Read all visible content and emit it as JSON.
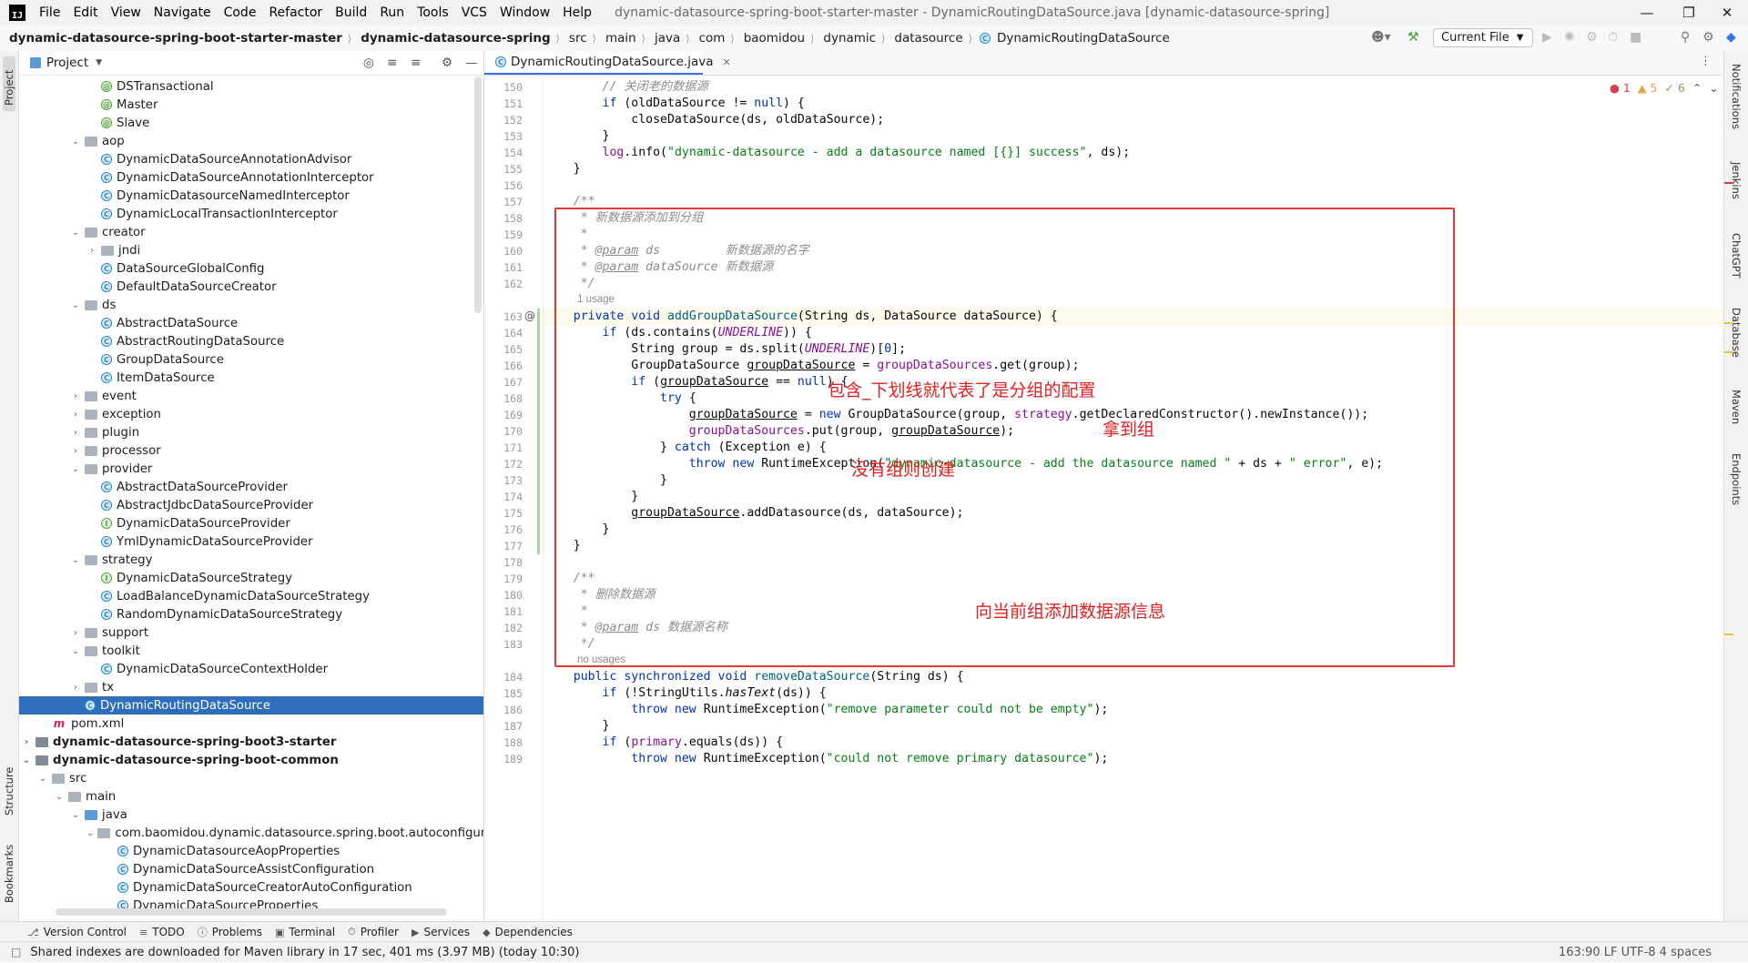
{
  "menubar": {
    "items": [
      "File",
      "Edit",
      "View",
      "Navigate",
      "Code",
      "Refactor",
      "Build",
      "Run",
      "Tools",
      "VCS",
      "Window",
      "Help"
    ],
    "window_title": "dynamic-datasource-spring-boot-starter-master - DynamicRoutingDataSource.java [dynamic-datasource-spring]",
    "logo_text": "IJ"
  },
  "navbar": {
    "breadcrumbs": [
      "dynamic-datasource-spring-boot-starter-master",
      "dynamic-datasource-spring",
      "src",
      "main",
      "java",
      "com",
      "baomidou",
      "dynamic",
      "datasource",
      "DynamicRoutingDataSource"
    ],
    "run_config": "Current File"
  },
  "project_panel": {
    "title": "Project",
    "rows": [
      {
        "label": "DSTransactional",
        "icon": "anno",
        "indent": 5
      },
      {
        "label": "Master",
        "icon": "anno",
        "indent": 5
      },
      {
        "label": "Slave",
        "icon": "anno",
        "indent": 5
      },
      {
        "label": "aop",
        "icon": "folder",
        "indent": 4,
        "arrow": "down"
      },
      {
        "label": "DynamicDataSourceAnnotationAdvisor",
        "icon": "class",
        "indent": 5
      },
      {
        "label": "DynamicDataSourceAnnotationInterceptor",
        "icon": "class",
        "indent": 5
      },
      {
        "label": "DynamicDatasourceNamedInterceptor",
        "icon": "class",
        "indent": 5
      },
      {
        "label": "DynamicLocalTransactionInterceptor",
        "icon": "class",
        "indent": 5
      },
      {
        "label": "creator",
        "icon": "folder",
        "indent": 4,
        "arrow": "down"
      },
      {
        "label": "jndi",
        "icon": "folder",
        "indent": 5,
        "arrow": "right"
      },
      {
        "label": "DataSourceGlobalConfig",
        "icon": "class",
        "indent": 5
      },
      {
        "label": "DefaultDataSourceCreator",
        "icon": "class",
        "indent": 5
      },
      {
        "label": "ds",
        "icon": "folder",
        "indent": 4,
        "arrow": "down"
      },
      {
        "label": "AbstractDataSource",
        "icon": "class",
        "indent": 5
      },
      {
        "label": "AbstractRoutingDataSource",
        "icon": "class",
        "indent": 5
      },
      {
        "label": "GroupDataSource",
        "icon": "class",
        "indent": 5
      },
      {
        "label": "ItemDataSource",
        "icon": "class",
        "indent": 5
      },
      {
        "label": "event",
        "icon": "folder",
        "indent": 4,
        "arrow": "right"
      },
      {
        "label": "exception",
        "icon": "folder",
        "indent": 4,
        "arrow": "right"
      },
      {
        "label": "plugin",
        "icon": "folder",
        "indent": 4,
        "arrow": "right"
      },
      {
        "label": "processor",
        "icon": "folder",
        "indent": 4,
        "arrow": "right"
      },
      {
        "label": "provider",
        "icon": "folder",
        "indent": 4,
        "arrow": "down"
      },
      {
        "label": "AbstractDataSourceProvider",
        "icon": "class",
        "indent": 5
      },
      {
        "label": "AbstractJdbcDataSourceProvider",
        "icon": "class",
        "indent": 5
      },
      {
        "label": "DynamicDataSourceProvider",
        "icon": "iface",
        "indent": 5
      },
      {
        "label": "YmlDynamicDataSourceProvider",
        "icon": "class",
        "indent": 5
      },
      {
        "label": "strategy",
        "icon": "folder",
        "indent": 4,
        "arrow": "down"
      },
      {
        "label": "DynamicDataSourceStrategy",
        "icon": "iface",
        "indent": 5
      },
      {
        "label": "LoadBalanceDynamicDataSourceStrategy",
        "icon": "class",
        "indent": 5
      },
      {
        "label": "RandomDynamicDataSourceStrategy",
        "icon": "class",
        "indent": 5
      },
      {
        "label": "support",
        "icon": "folder",
        "indent": 4,
        "arrow": "right"
      },
      {
        "label": "toolkit",
        "icon": "folder",
        "indent": 4,
        "arrow": "down"
      },
      {
        "label": "DynamicDataSourceContextHolder",
        "icon": "class",
        "indent": 5
      },
      {
        "label": "tx",
        "icon": "folder",
        "indent": 4,
        "arrow": "right"
      },
      {
        "label": "DynamicRoutingDataSource",
        "icon": "class",
        "indent": 4,
        "selected": true
      },
      {
        "label": "pom.xml",
        "icon": "maven",
        "indent": 2
      },
      {
        "label": "dynamic-datasource-spring-boot3-starter",
        "icon": "module",
        "indent": 1,
        "arrow": "right",
        "bold": true
      },
      {
        "label": "dynamic-datasource-spring-boot-common",
        "icon": "module",
        "indent": 1,
        "arrow": "down",
        "bold": true
      },
      {
        "label": "src",
        "icon": "folder",
        "indent": 2,
        "arrow": "down"
      },
      {
        "label": "main",
        "icon": "folder",
        "indent": 3,
        "arrow": "down"
      },
      {
        "label": "java",
        "icon": "folder-blue",
        "indent": 4,
        "arrow": "down"
      },
      {
        "label": "com.baomidou.dynamic.datasource.spring.boot.autoconfigure",
        "icon": "folder",
        "indent": 5,
        "arrow": "down"
      },
      {
        "label": "DynamicDatasourceAopProperties",
        "icon": "class",
        "indent": 6
      },
      {
        "label": "DynamicDataSourceAssistConfiguration",
        "icon": "class",
        "indent": 6
      },
      {
        "label": "DynamicDataSourceCreatorAutoConfiguration",
        "icon": "class",
        "indent": 6
      },
      {
        "label": "DynamicDataSourceProperties",
        "icon": "class",
        "indent": 6
      }
    ]
  },
  "editor": {
    "tab_label": "DynamicRoutingDataSource.java",
    "inspections": {
      "errors": "1",
      "warnings": "5",
      "weak": "6"
    },
    "lines": [
      {
        "n": "150",
        "html": "        <span class=\"cm\">// 关闭老的数据源</span>"
      },
      {
        "n": "151",
        "html": "        <span class=\"kw\">if</span> (oldDataSource != <span class=\"kw\">null</span>) {"
      },
      {
        "n": "152",
        "html": "            closeDataSource(ds, oldDataSource);"
      },
      {
        "n": "153",
        "html": "        }"
      },
      {
        "n": "154",
        "html": "        <span class=\"log\">log</span>.info(<span class=\"str\">\"dynamic-datasource - add a datasource named [{}] success\"</span>, ds);"
      },
      {
        "n": "155",
        "html": "    }"
      },
      {
        "n": "156",
        "html": ""
      },
      {
        "n": "157",
        "html": "    <span class=\"cj\">/**</span>"
      },
      {
        "n": "158",
        "html": "    <span class=\"cj\"> * 新数据源添加到分组</span>"
      },
      {
        "n": "159",
        "html": "    <span class=\"cj\"> *</span>"
      },
      {
        "n": "160",
        "html": "    <span class=\"cj\"> * <span class=\"tag\">@param</span> ds         新数据源的名字</span>"
      },
      {
        "n": "161",
        "html": "    <span class=\"cj\"> * <span class=\"tag\">@param</span> dataSource 新数据源</span>"
      },
      {
        "n": "162",
        "html": "    <span class=\"cj\"> */</span>"
      },
      {
        "n": "163",
        "html": "    <span class=\"kw\">private void</span> <span class=\"fn\">addGroupDataSource</span>(String ds, DataSource dataSource) {"
      },
      {
        "n": "164",
        "html": "        <span class=\"kw\">if</span> (ds.contains(<span class=\"const\">UNDERLINE</span>)) {"
      },
      {
        "n": "165",
        "html": "            String group = ds.split(<span class=\"const\">UNDERLINE</span>)[<span class=\"kw\">0</span>];"
      },
      {
        "n": "166",
        "html": "            GroupDataSource <span class=\"ul\">groupDataSource</span> = <span class=\"fld\">groupDataSources</span>.get(group);"
      },
      {
        "n": "167",
        "html": "            <span class=\"kw\">if</span> (<span class=\"ul\">groupDataSource</span> == <span class=\"kw\">null</span>) {"
      },
      {
        "n": "168",
        "html": "                <span class=\"kw\">try</span> {"
      },
      {
        "n": "169",
        "html": "                    <span class=\"ul\">groupDataSource</span> = <span class=\"kw\">new</span> GroupDataSource(group, <span class=\"fld\">strategy</span>.getDeclaredConstructor().newInstance());"
      },
      {
        "n": "170",
        "html": "                    <span class=\"fld\">groupDataSources</span>.put(group, <span class=\"ul\">groupDataSource</span>);"
      },
      {
        "n": "171",
        "html": "                } <span class=\"kw\">catch</span> (Exception e) {"
      },
      {
        "n": "172",
        "html": "                    <span class=\"kw\">throw new</span> RuntimeException(<span class=\"str\">\"dynamic-datasource - add the datasource named \"</span> + ds + <span class=\"str\">\" error\"</span>, e);"
      },
      {
        "n": "173",
        "html": "                }"
      },
      {
        "n": "174",
        "html": "            }"
      },
      {
        "n": "175",
        "html": "            <span class=\"ul\">groupDataSource</span>.addDatasource(ds, dataSource);"
      },
      {
        "n": "176",
        "html": "        }"
      },
      {
        "n": "177",
        "html": "    }"
      },
      {
        "n": "178",
        "html": ""
      },
      {
        "n": "179",
        "html": "    <span class=\"cj\">/**</span>"
      },
      {
        "n": "180",
        "html": "    <span class=\"cj\"> * 删除数据源</span>"
      },
      {
        "n": "181",
        "html": "    <span class=\"cj\"> *</span>"
      },
      {
        "n": "182",
        "html": "    <span class=\"cj\"> * <span class=\"tag\">@param</span> ds 数据源名称</span>"
      },
      {
        "n": "183",
        "html": "    <span class=\"cj\"> */</span>"
      },
      {
        "n": "184",
        "html": "    <span class=\"kw\">public synchronized void</span> <span class=\"fn\">removeDataSource</span>(String ds) {"
      },
      {
        "n": "185",
        "html": "        <span class=\"kw\">if</span> (!StringUtils.<i>hasText</i>(ds)) {"
      },
      {
        "n": "186",
        "html": "            <span class=\"kw\">throw new</span> RuntimeException(<span class=\"str\">\"remove parameter could not be empty\"</span>);"
      },
      {
        "n": "187",
        "html": "        }"
      },
      {
        "n": "188",
        "html": "        <span class=\"kw\">if</span> (<span class=\"fld\">primary</span>.equals(ds)) {"
      },
      {
        "n": "189",
        "html": "            <span class=\"kw\">throw new</span> RuntimeException(<span class=\"str\">\"could not remove primary datasource\"</span>);"
      }
    ],
    "hints": {
      "usage_1": "1 usage",
      "usage_none": "no usages"
    },
    "annotations": {
      "a1": "包含_下划线就代表了是分组的配置",
      "a2": "拿到组",
      "a3": "没有组则创建",
      "a4": "向当前组添加数据源信息"
    }
  },
  "left_strip": {
    "project": "Project",
    "structure": "Structure",
    "bookmarks": "Bookmarks"
  },
  "right_strip": {
    "notifications": "Notifications",
    "jenkins": "Jenkins",
    "chatgpt": "ChatGPT",
    "database": "Database",
    "maven": "Maven",
    "endpoints": "Endpoints"
  },
  "bottom_tools": [
    "Version Control",
    "TODO",
    "Problems",
    "Terminal",
    "Profiler",
    "Services",
    "Dependencies"
  ],
  "status": {
    "message": "Shared indexes are downloaded for Maven library in 17 sec, 401 ms (3.97 MB) (today 10:30)",
    "right": "163:90  LF  UTF-8  4 spaces"
  },
  "colors": {
    "accent": "#2f6ebd",
    "annotation_red": "#e02020",
    "redbox": "#e53935"
  }
}
